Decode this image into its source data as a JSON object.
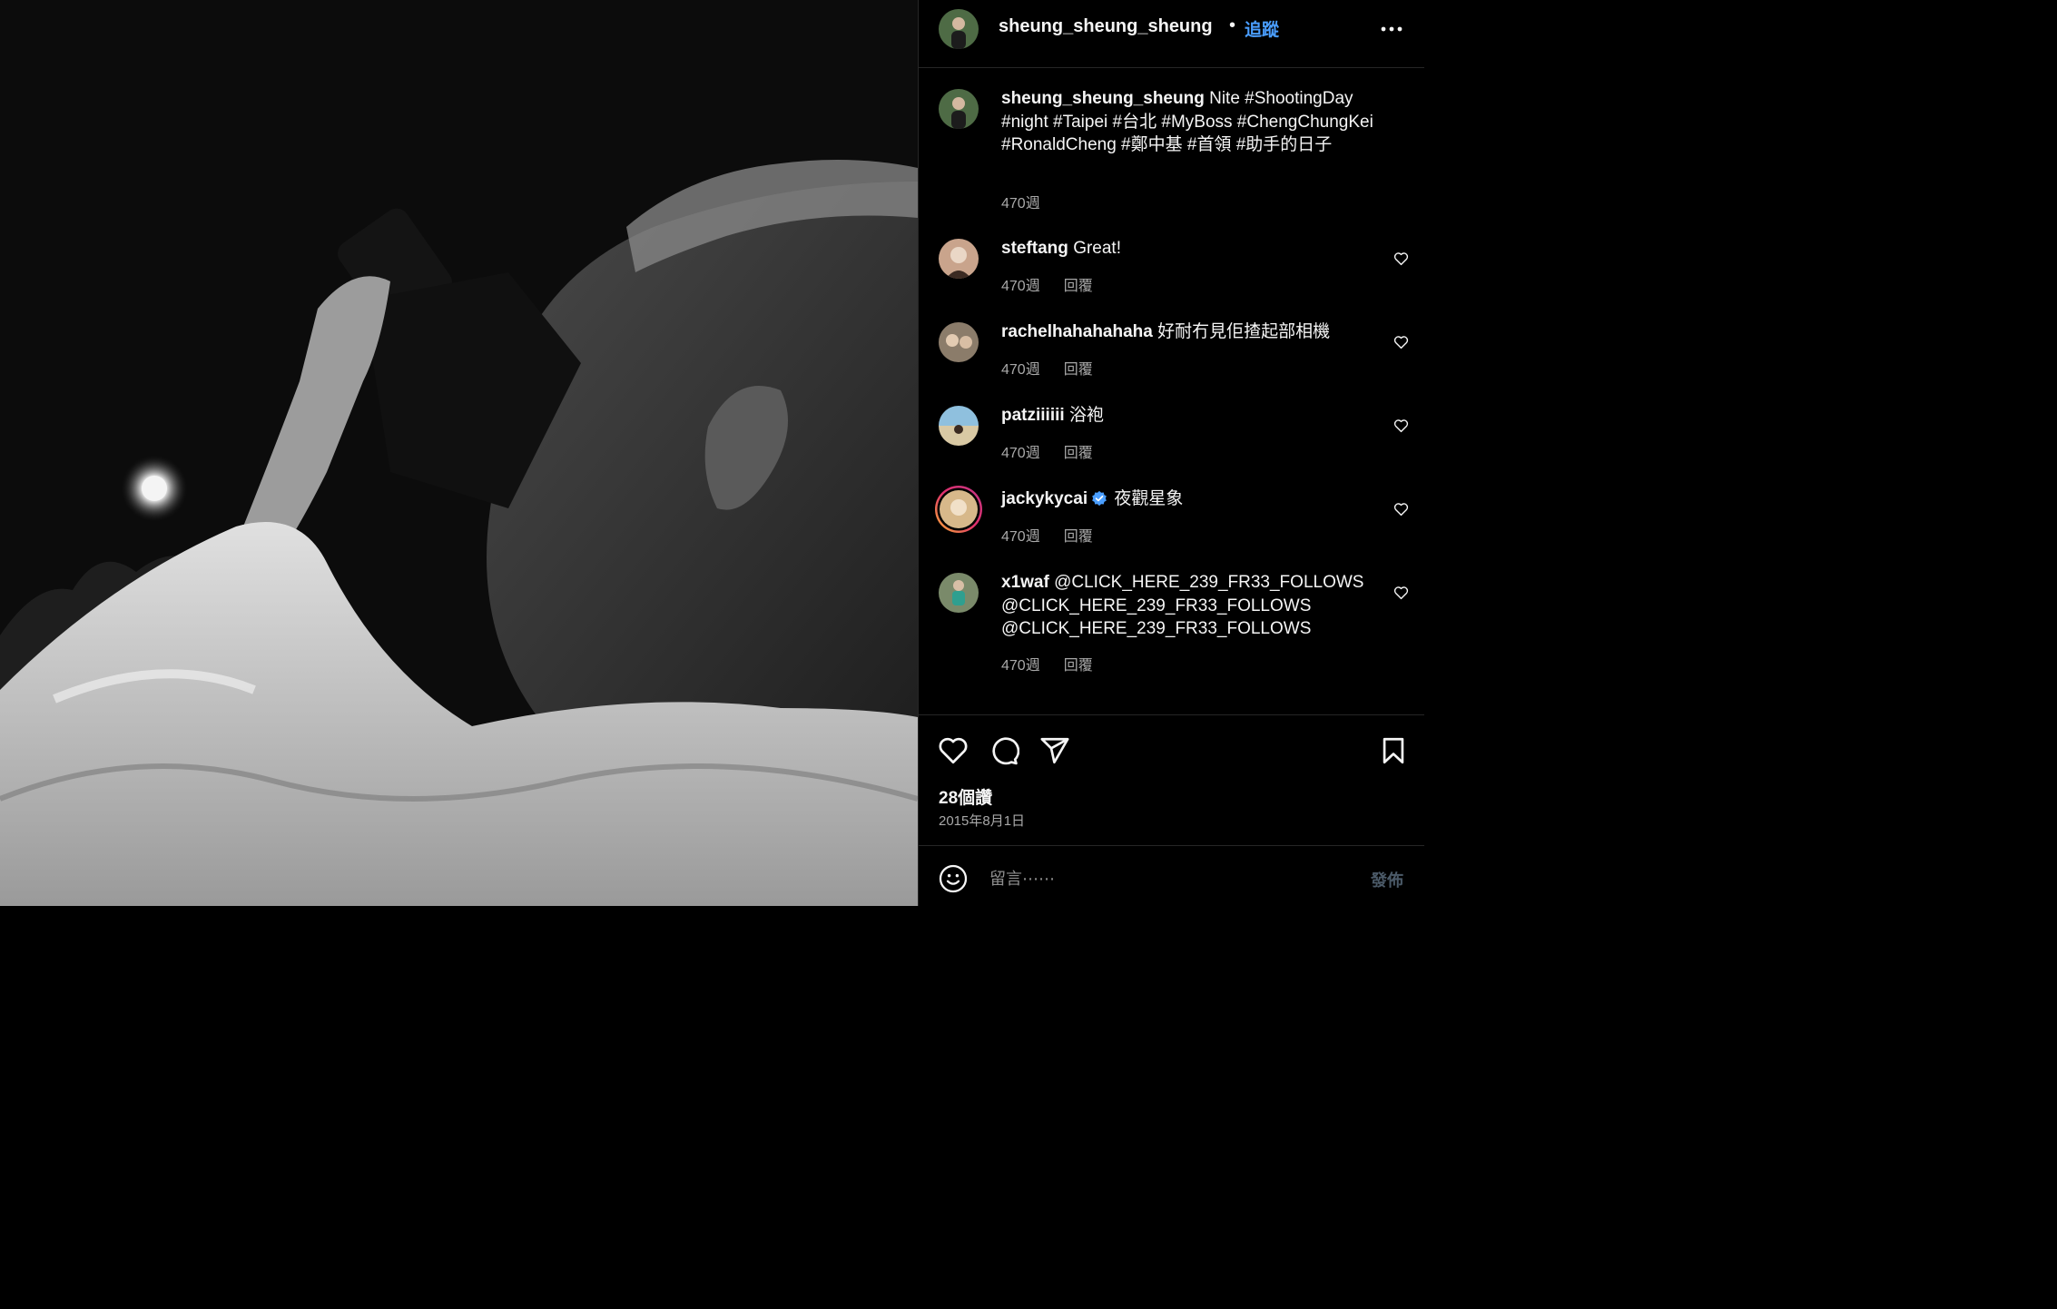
{
  "post": {
    "image_alt": "Black-and-white night photo of a man looking through a camera viewfinder",
    "author": {
      "username": "sheung_sheung_sheung"
    },
    "header": {
      "dot": "•",
      "follow_label": "追蹤",
      "more_icon": "more-horizontal-icon"
    },
    "caption": {
      "username": "sheung_sheung_sheung",
      "text": "Nite #ShootingDay #night #Taipei #台北 #MyBoss #ChengChungKei #RonaldCheng #鄭中基 #首領 #助手的日子",
      "age": "470週"
    },
    "comments": [
      {
        "username": "steftang",
        "text": "Great!",
        "age": "470週",
        "reply_label": "回覆",
        "verified": false,
        "avatar_color": "#c9a48c"
      },
      {
        "username": "rachelhahahahaha",
        "text": "好耐冇見佢揸起部相機",
        "age": "470週",
        "reply_label": "回覆",
        "verified": false,
        "avatar_color": "#8b7c6a"
      },
      {
        "username": "patziiiiii",
        "text": "浴袍",
        "age": "470週",
        "reply_label": "回覆",
        "verified": false,
        "avatar_color": "#6fa6c4"
      },
      {
        "username": "jackykycai",
        "text": "夜觀星象",
        "age": "470週",
        "reply_label": "回覆",
        "verified": true,
        "avatar_color": "#d7b88a"
      },
      {
        "username": "x1waf",
        "text": "@CLICK_HERE_239_FR33_FOLLOWS @CLICK_HERE_239_FR33_FOLLOWS @CLICK_HERE_239_FR33_FOLLOWS",
        "age": "470週",
        "reply_label": "回覆",
        "verified": false,
        "avatar_color": "#4f8f6f"
      }
    ],
    "likes_label": "28個讚",
    "date": "2015年8月1日",
    "composer": {
      "placeholder": "留言⋯⋯",
      "post_label": "發佈"
    }
  },
  "colors": {
    "accent": "#4a9eff",
    "muted": "#a8a8a8",
    "divider": "#262626",
    "post_disabled": "#4b5a68"
  }
}
